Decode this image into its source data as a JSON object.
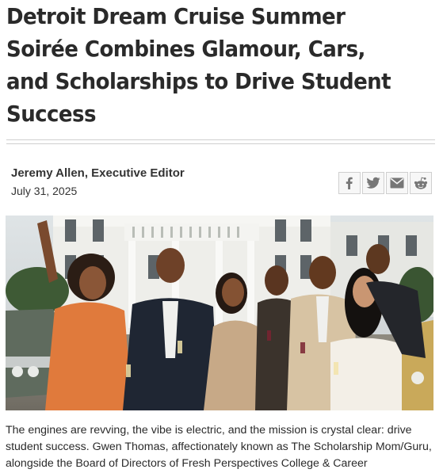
{
  "article": {
    "headline": "Detroit Dream Cruise Summer Soirée Combines Glamour, Cars, and Scholarships to Drive Student Success",
    "author": "Jeremy Allen, Executive Editor",
    "date": "July 31, 2025",
    "body": "The engines are revving, the vibe is electric, and the mission is crystal clear: drive student success. Gwen Thomas, affectionately known as The Scholarship Mom/Guru, alongside the Board of Directors of Fresh Perspectives College & Career"
  },
  "share": {
    "icons": [
      "facebook-icon",
      "twitter-icon",
      "email-icon",
      "reddit-icon"
    ]
  },
  "colors": {
    "icon_gray": "#777777",
    "rule": "#cfcfcf",
    "dress_orange": "#e07a3c"
  }
}
